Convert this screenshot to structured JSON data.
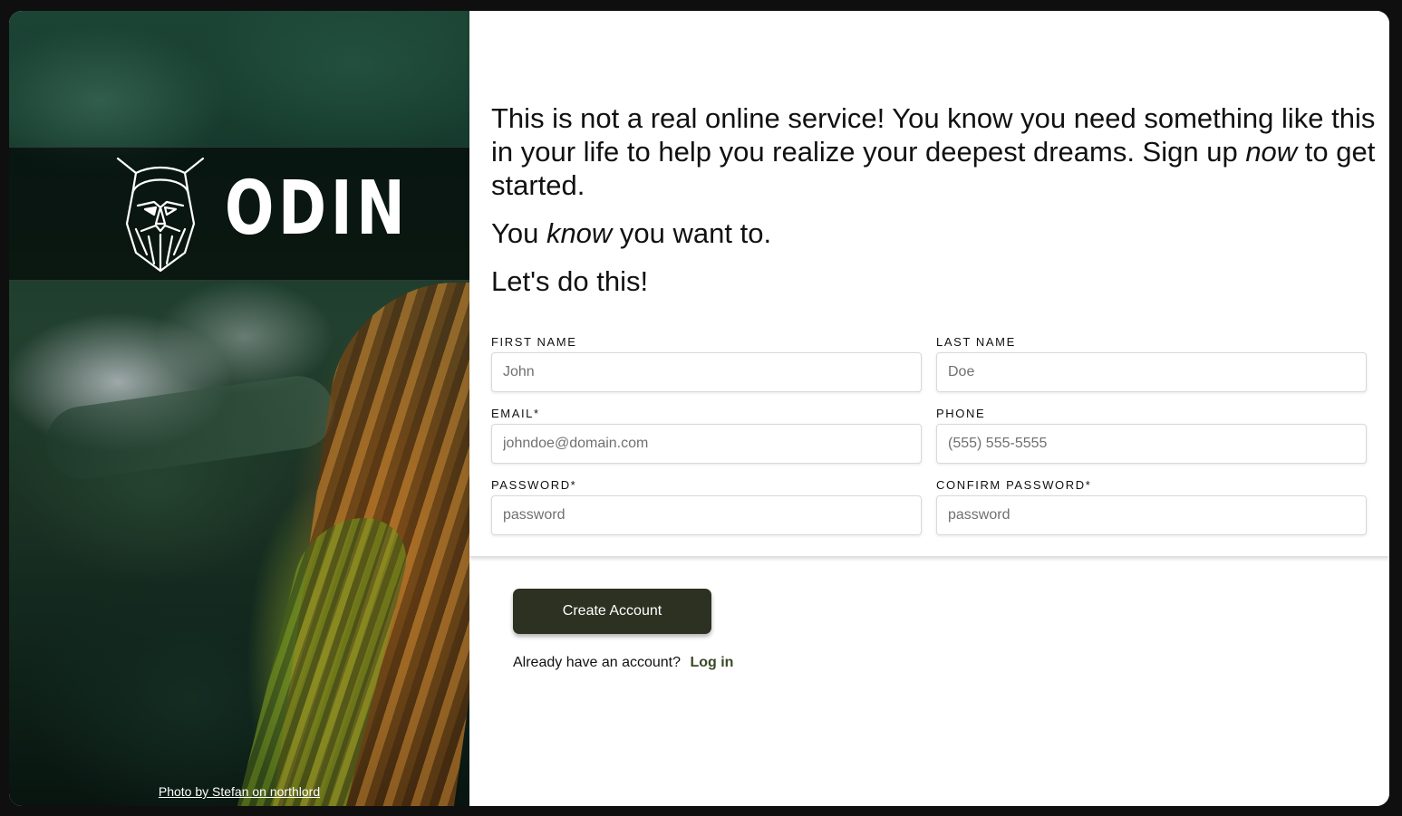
{
  "brand": {
    "name": "ODIN",
    "logo_icon": "viking-head-icon"
  },
  "hero": {
    "photo_credit": "Photo by Stefan on northlord"
  },
  "intro": {
    "p1_before": "This is not a real online service! You know you need something like this in your life to help you realize your deepest dreams. Sign up ",
    "p1_emphasis": "now",
    "p1_after": " to get started.",
    "p2_before": "You ",
    "p2_emphasis": "know",
    "p2_after": " you want to.",
    "p3": "Let's do this!"
  },
  "form": {
    "first_name": {
      "label": "FIRST NAME",
      "placeholder": "John",
      "value": ""
    },
    "last_name": {
      "label": "LAST NAME",
      "placeholder": "Doe",
      "value": ""
    },
    "email": {
      "label": "EMAIL*",
      "placeholder": "johndoe@domain.com",
      "value": ""
    },
    "phone": {
      "label": "PHONE",
      "placeholder": "(555) 555-5555",
      "value": ""
    },
    "password": {
      "label": "PASSWORD*",
      "placeholder": "password",
      "value": ""
    },
    "confirm_password": {
      "label": "CONFIRM PASSWORD*",
      "placeholder": "password",
      "value": ""
    }
  },
  "actions": {
    "create_account_label": "Create Account",
    "login_prompt": "Already have an account?",
    "login_link": "Log in"
  },
  "colors": {
    "button_bg": "#2c3122",
    "link": "#3a4a28",
    "page_bg": "#0f0f0f"
  }
}
